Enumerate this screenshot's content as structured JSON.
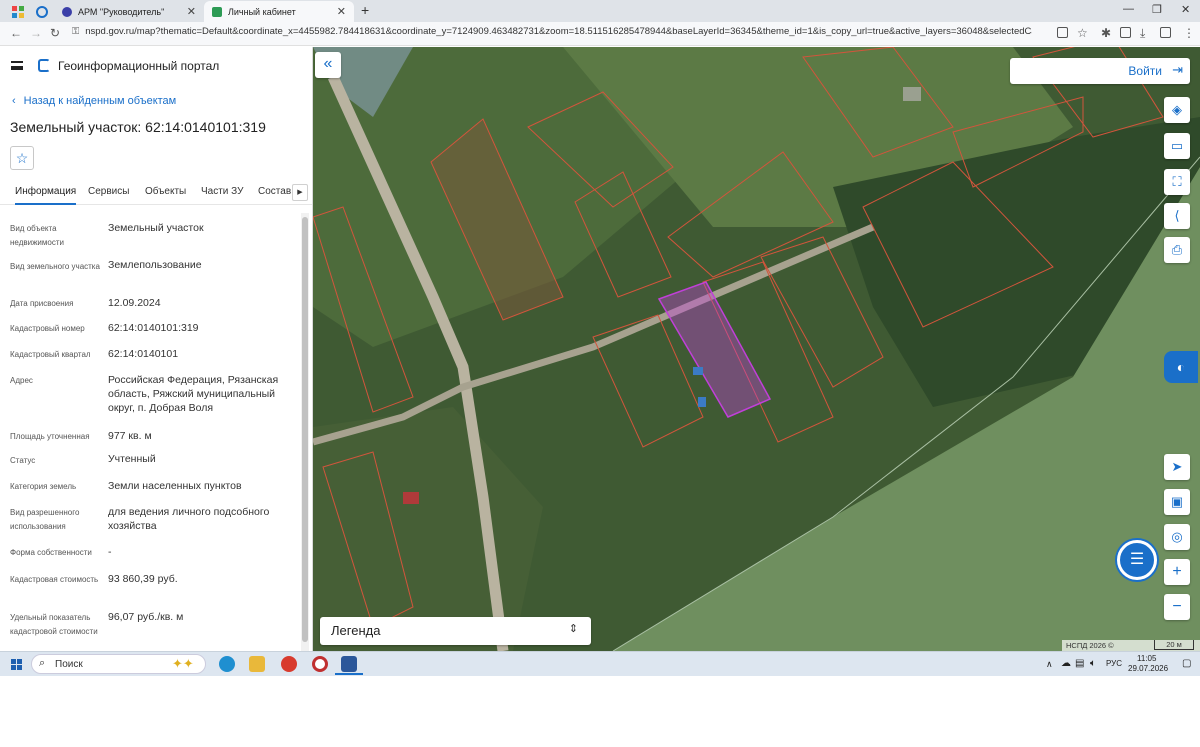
{
  "browser": {
    "tabs": [
      {
        "label": "АРМ \"Руководитель\"",
        "active": false
      },
      {
        "label": "Личный кабинет",
        "active": true
      }
    ],
    "url": "nspd.gov.ru/map?thematic=Default&coordinate_x=4455982.784418631&coordinate_y=7124909.463482731&zoom=18.511516285478944&baseLayerId=36345&theme_id=1&is_copy_url=true&active_layers=36048&selectedCard=291114390%2C3..."
  },
  "portal": {
    "title": "Геоинформационный портал",
    "back_label": "Назад к найденным объектам",
    "card_title": "Земельный участок: 62:14:0140101:319",
    "tabs": [
      "Информация",
      "Сервисы",
      "Объекты",
      "Части ЗУ",
      "Состав"
    ],
    "attributes": [
      {
        "label": "Вид объекта недвижимости",
        "value": "Земельный участок"
      },
      {
        "label": "Вид земельного участка",
        "value": "Землепользование"
      },
      {
        "label": "Дата присвоения",
        "value": "12.09.2024"
      },
      {
        "label": "Кадастровый номер",
        "value": "62:14:0140101:319"
      },
      {
        "label": "Кадастровый квартал",
        "value": "62:14:0140101"
      },
      {
        "label": "Адрес",
        "value": "Российская Федерация, Рязанская область, Ряжский муниципальный округ, п. Добрая Воля"
      },
      {
        "label": "Площадь уточненная",
        "value": "977 кв. м"
      },
      {
        "label": "Статус",
        "value": "Учтенный"
      },
      {
        "label": "Категория земель",
        "value": "Земли населенных пунктов"
      },
      {
        "label": "Вид разрешенного использования",
        "value": "для ведения личного подсобного хозяйства"
      },
      {
        "label": "Форма собственности",
        "value": "-"
      },
      {
        "label": "Кадастровая стоимость",
        "value": "93 860,39 руб."
      },
      {
        "label": "Удельный показатель кадастровой стоимости",
        "value": "96,07 руб./кв. м"
      }
    ]
  },
  "map": {
    "login_label": "Войти",
    "legend_label": "Легенда",
    "attribution": "НСПД 2026 ©",
    "scale_label": "20 м",
    "tools": [
      "layers-icon",
      "ruler-icon",
      "select-area-icon",
      "share-icon",
      "print-icon"
    ],
    "nav_tools": [
      "locate-icon",
      "basemap-icon",
      "geolocation-icon"
    ],
    "colors": {
      "accent": "#1a6fc9",
      "selected_parcel": "#c040d8",
      "parcel_border": "#d2553c"
    }
  },
  "taskbar": {
    "search_label": "Поиск",
    "language": "РУС",
    "time": "11:05",
    "date": "29.07.2026"
  }
}
